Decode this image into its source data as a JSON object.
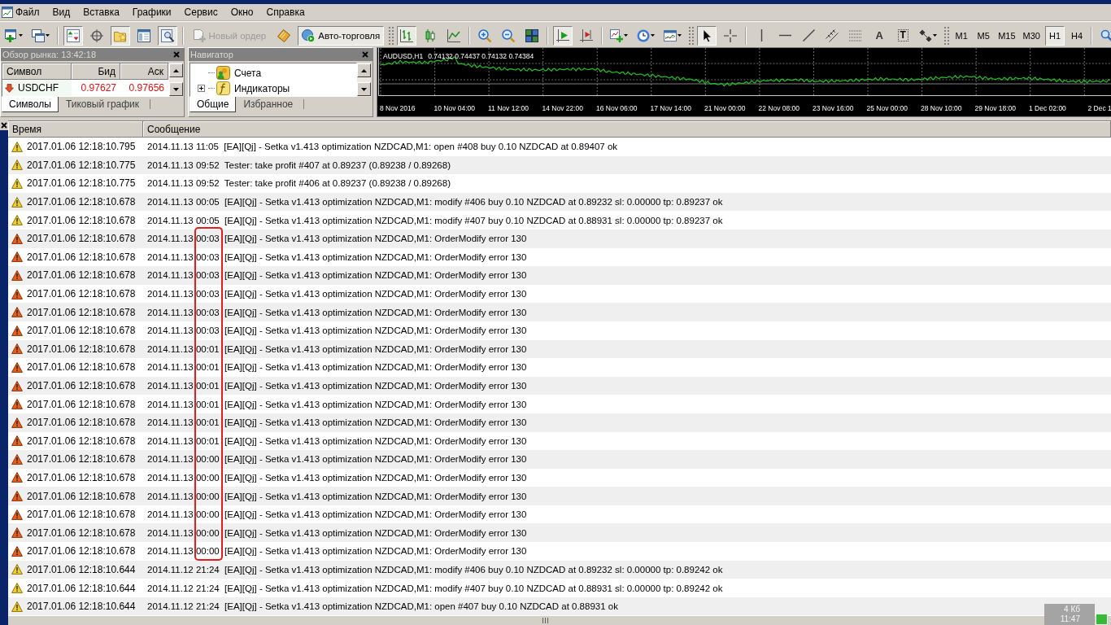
{
  "menu_bar": {
    "items": [
      "Файл",
      "Вид",
      "Вставка",
      "Графики",
      "Сервис",
      "Окно",
      "Справка"
    ]
  },
  "toolbar": [
    {
      "kind": "icon",
      "pressed": false
    },
    {
      "kind": "icon",
      "pressed": false
    },
    {
      "kind": "separator"
    },
    {
      "kind": "icon",
      "pressed": true
    },
    {
      "kind": "icon",
      "pressed": false
    },
    {
      "kind": "icon",
      "pressed": true
    },
    {
      "kind": "icon",
      "pressed": false
    },
    {
      "kind": "icon",
      "pressed": true
    },
    {
      "kind": "separator"
    },
    {
      "kind": "text",
      "label": "Новый ордер",
      "pressed": false,
      "disabled": true
    },
    {
      "kind": "icon",
      "pressed": false
    },
    {
      "kind": "text",
      "label": "Авто-торговля",
      "pressed": true,
      "disabled": false
    },
    {
      "kind": "grip"
    },
    {
      "kind": "icon",
      "pressed": true
    },
    {
      "kind": "icon",
      "pressed": false
    },
    {
      "kind": "icon",
      "pressed": false
    },
    {
      "kind": "separator"
    },
    {
      "kind": "icon",
      "pressed": false
    },
    {
      "kind": "icon",
      "pressed": false
    },
    {
      "kind": "icon",
      "pressed": false
    },
    {
      "kind": "separator"
    },
    {
      "kind": "icon",
      "pressed": true
    },
    {
      "kind": "icon",
      "pressed": false
    },
    {
      "kind": "separator"
    },
    {
      "kind": "icon",
      "pressed": false
    },
    {
      "kind": "icon",
      "pressed": false
    },
    {
      "kind": "icon",
      "pressed": false
    },
    {
      "kind": "grip"
    },
    {
      "kind": "icon",
      "pressed": true
    },
    {
      "kind": "icon",
      "pressed": false
    },
    {
      "kind": "separator"
    },
    {
      "kind": "icon",
      "pressed": false
    },
    {
      "kind": "icon",
      "pressed": false
    },
    {
      "kind": "icon",
      "pressed": false
    },
    {
      "kind": "icon",
      "pressed": false
    },
    {
      "kind": "icon",
      "pressed": false
    },
    {
      "kind": "letter",
      "label": "A",
      "pressed": false
    },
    {
      "kind": "framed-letter",
      "label": "T",
      "pressed": false
    },
    {
      "kind": "icon",
      "pressed": false
    },
    {
      "kind": "grip"
    },
    {
      "kind": "timeframe",
      "label": "M1",
      "selected": false
    },
    {
      "kind": "timeframe",
      "label": "M5",
      "selected": false
    },
    {
      "kind": "timeframe",
      "label": "M15",
      "selected": false
    },
    {
      "kind": "timeframe",
      "label": "M30",
      "selected": false
    },
    {
      "kind": "timeframe",
      "label": "H1",
      "selected": true
    },
    {
      "kind": "timeframe",
      "label": "H4",
      "selected": false
    },
    {
      "kind": "separator"
    },
    {
      "kind": "icon",
      "pressed": false
    }
  ],
  "market_watch": {
    "title": "Обзор рынка: 13:42:18",
    "columns": [
      "Символ",
      "Бид",
      "Аск"
    ],
    "rows": [
      {
        "symbol": "USDCHF",
        "bid": "0.97627",
        "ask": "0.97656",
        "falling": true
      }
    ],
    "tabs": [
      {
        "label": "Символы",
        "selected": true
      },
      {
        "label": "Тиковый график",
        "selected": false
      }
    ]
  },
  "navigator": {
    "title": "Навигатор",
    "items": [
      {
        "label": "Счета",
        "kind": "leaf"
      },
      {
        "label": "Индикаторы",
        "kind": "group",
        "expanded": false
      }
    ],
    "tabs": [
      {
        "label": "Общие",
        "selected": true
      },
      {
        "label": "Избранное",
        "selected": false
      }
    ]
  },
  "chart": {
    "symbol": "AUDUSD,H1",
    "prices": "0.74132 0.74437 0.74132 0.74384",
    "time_labels": [
      "8 Nov 2016",
      "10 Nov 04:00",
      "11 Nov 12:00",
      "14 Nov 22:00",
      "16 Nov 06:00",
      "17 Nov 14:00",
      "21 Nov 00:00",
      "22 Nov 08:00",
      "23 Nov 16:00",
      "25 Nov 00:00",
      "28 Nov 10:00",
      "29 Nov 18:00",
      "1 Dec 02:00",
      "2 Dec 1"
    ]
  },
  "journal": {
    "columns": [
      "Время",
      "Сообщение"
    ],
    "rows": [
      {
        "kind": "warning",
        "time": "2017.01.06 12:18:10.795",
        "message": "2014.11.13 11:05  [EA][Qj] - Setka v1.413 optimization NZDCAD,M1: open #408 buy 0.10 NZDCAD at 0.89407 ok",
        "marked": false
      },
      {
        "kind": "warning",
        "time": "2017.01.06 12:18:10.775",
        "message": "2014.11.13 09:52  Tester: take profit #407 at 0.89237 (0.89238 / 0.89268)",
        "marked": false
      },
      {
        "kind": "warning",
        "time": "2017.01.06 12:18:10.775",
        "message": "2014.11.13 09:52  Tester: take profit #406 at 0.89237 (0.89238 / 0.89268)",
        "marked": false
      },
      {
        "kind": "warning",
        "time": "2017.01.06 12:18:10.678",
        "message": "2014.11.13 00:05  [EA][Qj] - Setka v1.413 optimization NZDCAD,M1: modify #406 buy 0.10 NZDCAD at 0.89232 sl: 0.00000 tp: 0.89237 ok",
        "marked": false
      },
      {
        "kind": "warning",
        "time": "2017.01.06 12:18:10.678",
        "message": "2014.11.13 00:05  [EA][Qj] - Setka v1.413 optimization NZDCAD,M1: modify #407 buy 0.10 NZDCAD at 0.88931 sl: 0.00000 tp: 0.89237 ok",
        "marked": false
      },
      {
        "kind": "error",
        "time": "2017.01.06 12:18:10.678",
        "message": "2014.11.13 00:03  [EA][Qj] - Setka v1.413 optimization NZDCAD,M1: OrderModify error 130",
        "marked": true
      },
      {
        "kind": "error",
        "time": "2017.01.06 12:18:10.678",
        "message": "2014.11.13 00:03  [EA][Qj] - Setka v1.413 optimization NZDCAD,M1: OrderModify error 130",
        "marked": true
      },
      {
        "kind": "error",
        "time": "2017.01.06 12:18:10.678",
        "message": "2014.11.13 00:03  [EA][Qj] - Setka v1.413 optimization NZDCAD,M1: OrderModify error 130",
        "marked": true
      },
      {
        "kind": "error",
        "time": "2017.01.06 12:18:10.678",
        "message": "2014.11.13 00:03  [EA][Qj] - Setka v1.413 optimization NZDCAD,M1: OrderModify error 130",
        "marked": true
      },
      {
        "kind": "error",
        "time": "2017.01.06 12:18:10.678",
        "message": "2014.11.13 00:03  [EA][Qj] - Setka v1.413 optimization NZDCAD,M1: OrderModify error 130",
        "marked": true
      },
      {
        "kind": "error",
        "time": "2017.01.06 12:18:10.678",
        "message": "2014.11.13 00:03  [EA][Qj] - Setka v1.413 optimization NZDCAD,M1: OrderModify error 130",
        "marked": true
      },
      {
        "kind": "error",
        "time": "2017.01.06 12:18:10.678",
        "message": "2014.11.13 00:01  [EA][Qj] - Setka v1.413 optimization NZDCAD,M1: OrderModify error 130",
        "marked": true
      },
      {
        "kind": "error",
        "time": "2017.01.06 12:18:10.678",
        "message": "2014.11.13 00:01  [EA][Qj] - Setka v1.413 optimization NZDCAD,M1: OrderModify error 130",
        "marked": true
      },
      {
        "kind": "error",
        "time": "2017.01.06 12:18:10.678",
        "message": "2014.11.13 00:01  [EA][Qj] - Setka v1.413 optimization NZDCAD,M1: OrderModify error 130",
        "marked": true
      },
      {
        "kind": "error",
        "time": "2017.01.06 12:18:10.678",
        "message": "2014.11.13 00:01  [EA][Qj] - Setka v1.413 optimization NZDCAD,M1: OrderModify error 130",
        "marked": true
      },
      {
        "kind": "error",
        "time": "2017.01.06 12:18:10.678",
        "message": "2014.11.13 00:01  [EA][Qj] - Setka v1.413 optimization NZDCAD,M1: OrderModify error 130",
        "marked": true
      },
      {
        "kind": "error",
        "time": "2017.01.06 12:18:10.678",
        "message": "2014.11.13 00:01  [EA][Qj] - Setka v1.413 optimization NZDCAD,M1: OrderModify error 130",
        "marked": true
      },
      {
        "kind": "error",
        "time": "2017.01.06 12:18:10.678",
        "message": "2014.11.13 00:00  [EA][Qj] - Setka v1.413 optimization NZDCAD,M1: OrderModify error 130",
        "marked": true
      },
      {
        "kind": "error",
        "time": "2017.01.06 12:18:10.678",
        "message": "2014.11.13 00:00  [EA][Qj] - Setka v1.413 optimization NZDCAD,M1: OrderModify error 130",
        "marked": true
      },
      {
        "kind": "error",
        "time": "2017.01.06 12:18:10.678",
        "message": "2014.11.13 00:00  [EA][Qj] - Setka v1.413 optimization NZDCAD,M1: OrderModify error 130",
        "marked": true
      },
      {
        "kind": "error",
        "time": "2017.01.06 12:18:10.678",
        "message": "2014.11.13 00:00  [EA][Qj] - Setka v1.413 optimization NZDCAD,M1: OrderModify error 130",
        "marked": true
      },
      {
        "kind": "error",
        "time": "2017.01.06 12:18:10.678",
        "message": "2014.11.13 00:00  [EA][Qj] - Setka v1.413 optimization NZDCAD,M1: OrderModify error 130",
        "marked": true
      },
      {
        "kind": "error",
        "time": "2017.01.06 12:18:10.678",
        "message": "2014.11.13 00:00  [EA][Qj] - Setka v1.413 optimization NZDCAD,M1: OrderModify error 130",
        "marked": true
      },
      {
        "kind": "warning",
        "time": "2017.01.06 12:18:10.644",
        "message": "2014.11.12 21:24  [EA][Qj] - Setka v1.413 optimization NZDCAD,M1: modify #406 buy 0.10 NZDCAD at 0.89232 sl: 0.00000 tp: 0.89242 ok",
        "marked": false
      },
      {
        "kind": "warning",
        "time": "2017.01.06 12:18:10.644",
        "message": "2014.11.12 21:24  [EA][Qj] - Setka v1.413 optimization NZDCAD,M1: modify #407 buy 0.10 NZDCAD at 0.88931 sl: 0.00000 tp: 0.89242 ok",
        "marked": false
      },
      {
        "kind": "warning",
        "time": "2017.01.06 12:18:10.644",
        "message": "2014.11.12 21:24  [EA][Qj] - Setka v1.413 optimization NZDCAD,M1: open #407 buy 0.10 NZDCAD at 0.88931 ok",
        "marked": false
      }
    ]
  },
  "status": {
    "size": "4 Кб",
    "clock": "11:47"
  }
}
